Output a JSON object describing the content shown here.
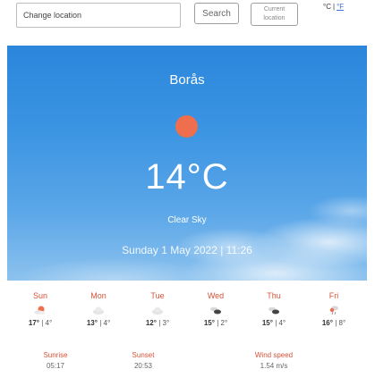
{
  "header": {
    "location_placeholder": "Change location",
    "search_label": "Search",
    "current_location_label": "Current location",
    "unit_celsius": "°C",
    "unit_separator": "|",
    "unit_fahrenheit": "°F"
  },
  "current": {
    "city": "Borås",
    "temperature": "14°C",
    "condition": "Clear Sky",
    "datetime": "Sunday 1 May 2022 | 11:26",
    "icon": "sun-icon",
    "sun_color": "#ef6e4e"
  },
  "forecast": [
    {
      "day": "Sun",
      "high": "17°",
      "sep": "|",
      "low": "4°",
      "icon": "partly-sunny-icon"
    },
    {
      "day": "Mon",
      "high": "13°",
      "sep": "|",
      "low": "4°",
      "icon": "cloud-icon"
    },
    {
      "day": "Tue",
      "high": "12°",
      "sep": "|",
      "low": "3°",
      "icon": "cloud-icon"
    },
    {
      "day": "Wed",
      "high": "15°",
      "sep": "|",
      "low": "2°",
      "icon": "broken-clouds-icon"
    },
    {
      "day": "Thu",
      "high": "15°",
      "sep": "|",
      "low": "4°",
      "icon": "broken-clouds-icon"
    },
    {
      "day": "Fri",
      "high": "16°",
      "sep": "|",
      "low": "8°",
      "icon": "rain-icon"
    }
  ],
  "details": {
    "sunrise_label": "Sunrise",
    "sunrise_value": "05:17",
    "sunset_label": "Sunset",
    "sunset_value": "20:53",
    "wind_label": "Wind speed",
    "wind_value": "1.54 m/s"
  },
  "colors": {
    "accent": "#d5533a",
    "link": "#3a6ed6",
    "sky_top": "#2b86dc"
  }
}
